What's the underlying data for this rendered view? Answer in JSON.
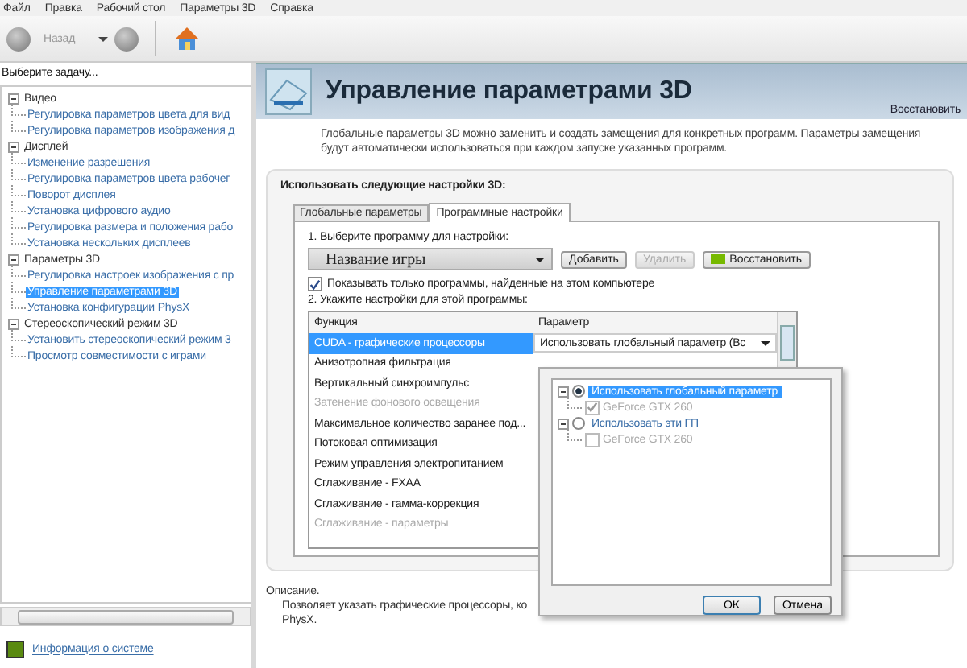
{
  "menu": [
    "Файл",
    "Правка",
    "Рабочий стол",
    "Параметры 3D",
    "Справка"
  ],
  "toolbar": {
    "back_label": "Назад"
  },
  "sidebar": {
    "heading": "Выберите задачу...",
    "tree": [
      {
        "label": "Видео",
        "expanded": true,
        "children": [
          {
            "label": "Регулировка параметров цвета для вид",
            "selected": false
          },
          {
            "label": "Регулировка параметров изображения д",
            "selected": false
          }
        ]
      },
      {
        "label": "Дисплей",
        "expanded": true,
        "children": [
          {
            "label": "Изменение разрешения",
            "selected": false
          },
          {
            "label": "Регулировка параметров цвета рабочег",
            "selected": false
          },
          {
            "label": "Поворот дисплея",
            "selected": false
          },
          {
            "label": "Установка цифрового аудио",
            "selected": false
          },
          {
            "label": "Регулировка размера и положения рабо",
            "selected": false
          },
          {
            "label": "Установка нескольких дисплеев",
            "selected": false
          }
        ]
      },
      {
        "label": "Параметры 3D",
        "expanded": true,
        "children": [
          {
            "label": "Регулировка настроек изображения с пр",
            "selected": false
          },
          {
            "label": "Управление параметрами 3D",
            "selected": true
          },
          {
            "label": "Установка конфигурации PhysX",
            "selected": false
          }
        ]
      },
      {
        "label": "Стереоскопический режим 3D",
        "expanded": true,
        "children": [
          {
            "label": "Установить стереоскопический режим 3",
            "selected": false
          },
          {
            "label": "Просмотр совместимости с играми",
            "selected": false
          }
        ]
      }
    ],
    "footer_link": "Информация о системе"
  },
  "page": {
    "title": "Управление параметрами 3D",
    "restore_link": "Восстановить",
    "intro": "Глобальные параметры 3D можно заменить и создать замещения для конкретных программ. Параметры замещения будут автоматически использоваться при каждом запуске указанных программ.",
    "panel_title": "Использовать следующие настройки 3D:",
    "tabs": [
      {
        "label": "Глобальные параметры",
        "selected": false
      },
      {
        "label": "Программные настройки",
        "selected": true
      }
    ],
    "step1": "1. Выберите программу для настройки:",
    "program": {
      "value": "Название игры"
    },
    "buttons": [
      {
        "label": "Добавить",
        "kind": "plain",
        "disabled": false
      },
      {
        "label": "Удалить",
        "kind": "plain",
        "disabled": true
      },
      {
        "label": "Восстановить",
        "kind": "icon",
        "disabled": false
      }
    ],
    "filter": {
      "label": "Показывать только программы, найденные на этом компьютере",
      "checked": true
    },
    "step2": "2. Укажите настройки для этой программы:",
    "table": {
      "columns": [
        "Функция",
        "Параметр"
      ],
      "rows": [
        {
          "function": "CUDA - графические процессоры",
          "value": "Использовать глобальный параметр (Вс",
          "selected": true,
          "disabled": false
        },
        {
          "function": "Анизотропная фильтрация",
          "selected": false,
          "disabled": false
        },
        {
          "function": "Вертикальный синхроимпульс",
          "selected": false,
          "disabled": false
        },
        {
          "function": "Затенение фонового освещения",
          "selected": false,
          "disabled": true
        },
        {
          "function": "Максимальное количество заранее под...",
          "selected": false,
          "disabled": false
        },
        {
          "function": "Потоковая оптимизация",
          "selected": false,
          "disabled": false
        },
        {
          "function": "Режим управления электропитанием",
          "selected": false,
          "disabled": false
        },
        {
          "function": "Сглаживание - FXAA",
          "selected": false,
          "disabled": false
        },
        {
          "function": "Сглаживание - гамма-коррекция",
          "selected": false,
          "disabled": false
        },
        {
          "function": "Сглаживание - параметры",
          "selected": false,
          "disabled": true
        }
      ]
    },
    "description": {
      "label": "Описание.",
      "lines": [
        "Позволяет указать графические процессоры, ко",
        "PhysX."
      ]
    }
  },
  "popup": {
    "options": [
      {
        "label": "Использовать глобальный параметр",
        "selected": true,
        "children": [
          {
            "label": "GeForce GTX 260",
            "checked": true,
            "disabled": true
          }
        ]
      },
      {
        "label": "Использовать эти ГП",
        "selected": false,
        "children": [
          {
            "label": "GeForce GTX 260",
            "checked": false,
            "disabled": true
          }
        ]
      }
    ],
    "buttons": [
      "OK",
      "Отмена"
    ]
  }
}
